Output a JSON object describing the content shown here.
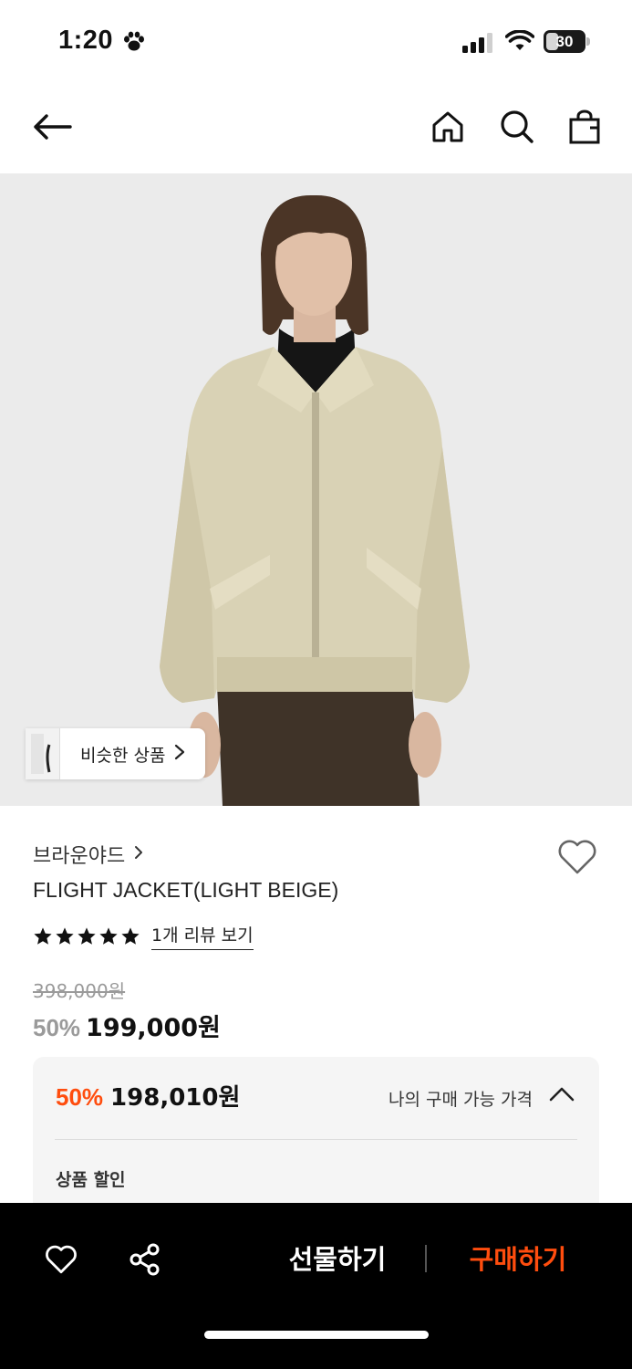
{
  "status_bar": {
    "time": "1:20",
    "battery": "30"
  },
  "product": {
    "similar_label": "비슷한 상품",
    "brand": "브라운야드",
    "name": "FLIGHT JACKET(LIGHT BEIGE)",
    "rating": 5,
    "review_link": "1개 리뷰 보기",
    "original_price": "398,000원",
    "discount_rate": "50%",
    "sale_price": "199,000원"
  },
  "my_price": {
    "discount_rate": "50%",
    "amount": "198,010원",
    "label": "나의 구매 가능 가격",
    "section_title": "상품 할인"
  },
  "bottom_bar": {
    "gift_label": "선물하기",
    "buy_label": "구매하기"
  },
  "colors": {
    "accent": "#ff4d0e",
    "bottom_bar_bg": "#000000",
    "image_bg": "#ebebeb"
  },
  "icons": [
    "paw-icon",
    "signal-icon",
    "wifi-icon",
    "battery-icon",
    "back-arrow-icon",
    "home-icon",
    "search-icon",
    "shopping-bag-icon",
    "chevron-right-icon",
    "heart-icon",
    "star-icon",
    "chevron-up-icon",
    "share-icon"
  ]
}
